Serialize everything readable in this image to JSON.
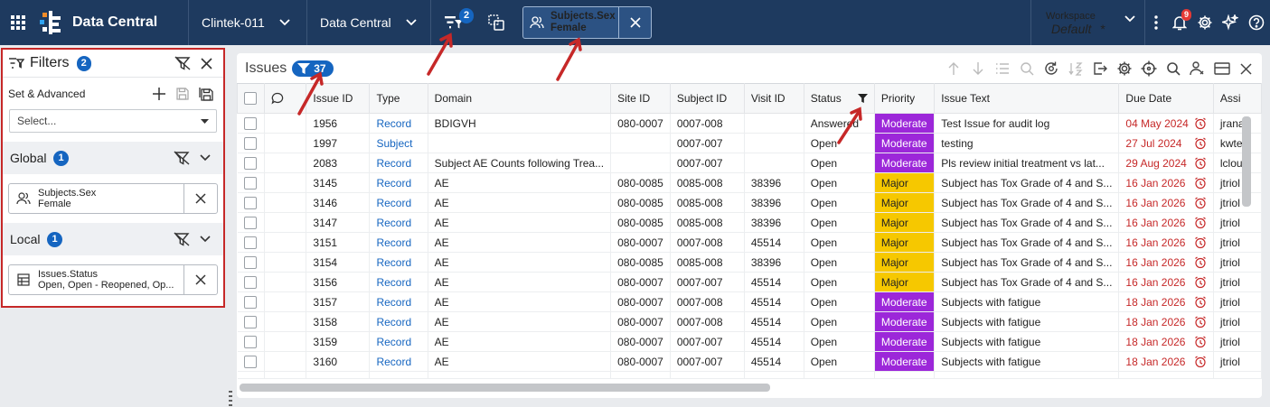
{
  "app": {
    "title": "Data Central",
    "study": "Clintek-011",
    "module": "Data Central",
    "filter_count": "2",
    "active_filter": {
      "field": "Subjects.Sex",
      "value": "Female"
    },
    "workspace_label": "Workspace",
    "workspace_value": "Default",
    "workspace_dirty": "*",
    "notification_count": "9"
  },
  "filters": {
    "title": "Filters",
    "count": "2",
    "set_label": "Set & Advanced",
    "select_placeholder": "Select...",
    "global": {
      "label": "Global",
      "count": "1",
      "chip": {
        "field": "Subjects.Sex",
        "value": "Female"
      }
    },
    "local": {
      "label": "Local",
      "count": "1",
      "chip": {
        "field": "Issues.Status",
        "value": "Open, Open - Reopened, Op..."
      }
    }
  },
  "issues": {
    "title": "Issues",
    "filtered_count": "37",
    "columns": [
      "",
      "",
      "Issue ID",
      "Type",
      "Domain",
      "Site ID",
      "Subject ID",
      "Visit ID",
      "Status",
      "Priority",
      "Issue Text",
      "Due Date",
      "Assi"
    ],
    "rows": [
      [
        "1956",
        "Record",
        "BDIGVH",
        "080-0007",
        "0007-008",
        "",
        "Answered",
        "Moderate",
        "Test Issue for audit log",
        "04 May 2024",
        "jrana"
      ],
      [
        "1997",
        "Subject",
        "",
        "",
        "0007-007",
        "",
        "Open",
        "Moderate",
        "testing",
        "27 Jul 2024",
        "kwte"
      ],
      [
        "2083",
        "Record",
        "Subject AE Counts following Trea...",
        "",
        "0007-007",
        "",
        "Open",
        "Moderate",
        "Pls review initial treatment vs lat...",
        "29 Aug 2024",
        "lclou"
      ],
      [
        "3145",
        "Record",
        "AE",
        "080-0085",
        "0085-008",
        "38396",
        "Open",
        "Major",
        "Subject has Tox Grade of 4 and S...",
        "16 Jan 2026",
        "jtriol"
      ],
      [
        "3146",
        "Record",
        "AE",
        "080-0085",
        "0085-008",
        "38396",
        "Open",
        "Major",
        "Subject has Tox Grade of 4 and S...",
        "16 Jan 2026",
        "jtriol"
      ],
      [
        "3147",
        "Record",
        "AE",
        "080-0085",
        "0085-008",
        "38396",
        "Open",
        "Major",
        "Subject has Tox Grade of 4 and S...",
        "16 Jan 2026",
        "jtriol"
      ],
      [
        "3151",
        "Record",
        "AE",
        "080-0007",
        "0007-008",
        "45514",
        "Open",
        "Major",
        "Subject has Tox Grade of 4 and S...",
        "16 Jan 2026",
        "jtriol"
      ],
      [
        "3154",
        "Record",
        "AE",
        "080-0085",
        "0085-008",
        "38396",
        "Open",
        "Major",
        "Subject has Tox Grade of 4 and S...",
        "16 Jan 2026",
        "jtriol"
      ],
      [
        "3156",
        "Record",
        "AE",
        "080-0007",
        "0007-007",
        "45514",
        "Open",
        "Major",
        "Subject has Tox Grade of 4 and S...",
        "16 Jan 2026",
        "jtriol"
      ],
      [
        "3157",
        "Record",
        "AE",
        "080-0007",
        "0007-008",
        "45514",
        "Open",
        "Moderate",
        "Subjects with fatigue",
        "18 Jan 2026",
        "jtriol"
      ],
      [
        "3158",
        "Record",
        "AE",
        "080-0007",
        "0007-008",
        "45514",
        "Open",
        "Moderate",
        "Subjects with fatigue",
        "18 Jan 2026",
        "jtriol"
      ],
      [
        "3159",
        "Record",
        "AE",
        "080-0007",
        "0007-007",
        "45514",
        "Open",
        "Moderate",
        "Subjects with fatigue",
        "18 Jan 2026",
        "jtriol"
      ],
      [
        "3160",
        "Record",
        "AE",
        "080-0007",
        "0007-007",
        "45514",
        "Open",
        "Moderate",
        "Subjects with fatigue",
        "18 Jan 2026",
        "jtriol"
      ]
    ]
  },
  "colors": {
    "topbar": "#1e3a5f",
    "accent": "#1565c0",
    "moderate": "#9c27d9",
    "major": "#f6c800",
    "due": "#c62828",
    "annotation": "#c62828"
  }
}
